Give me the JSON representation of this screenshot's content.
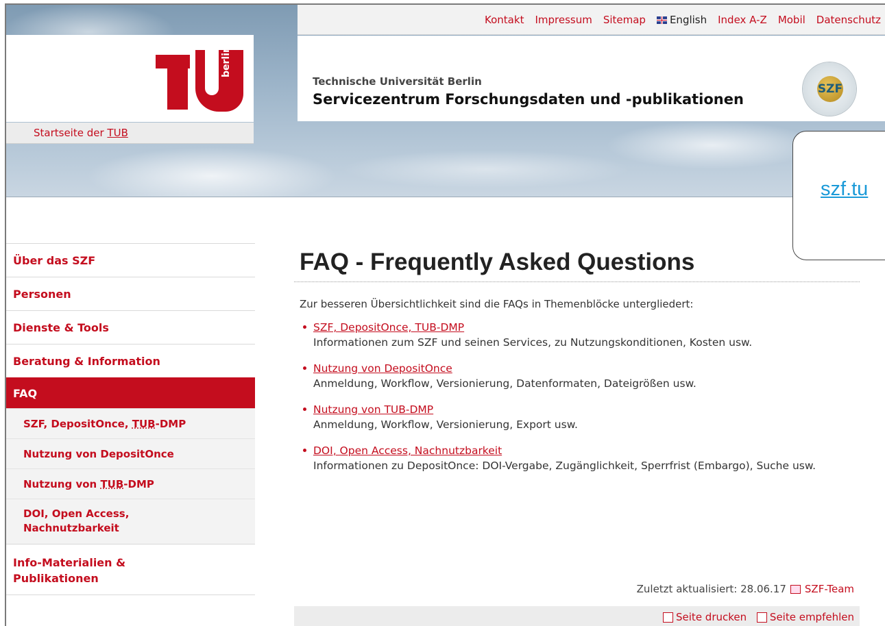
{
  "topnav": {
    "items": [
      "Kontakt",
      "Impressum",
      "Sitemap",
      "English",
      "Index A-Z",
      "Mobil",
      "Datenschutz"
    ]
  },
  "logo": {
    "text": "berlin"
  },
  "startbar": {
    "prefix": "Startseite der ",
    "abbr": "TUB"
  },
  "header": {
    "institution": "Technische Universität Berlin",
    "unit": "Servicezentrum Forschungsdaten und -publikationen",
    "seal": "SZF"
  },
  "callout": {
    "text": "szf.tu"
  },
  "sidebar": {
    "items": [
      {
        "label": "Über das SZF"
      },
      {
        "label": "Personen"
      },
      {
        "label": "Dienste & Tools"
      },
      {
        "label": "Beratung & Information"
      },
      {
        "label": "FAQ",
        "active": true
      }
    ],
    "sub": [
      {
        "label_a": "SZF, DepositOnce, ",
        "abbr": "TUB",
        "label_b": "-DMP"
      },
      {
        "label": "Nutzung von DepositOnce"
      },
      {
        "label_a": "Nutzung von ",
        "abbr": "TUB",
        "label_b": "-DMP"
      },
      {
        "line1": "DOI, Open Access,",
        "line2": "Nachnutzbarkeit"
      }
    ],
    "last": {
      "line1": "Info-Materialien &",
      "line2": "Publikationen"
    }
  },
  "main": {
    "title": "FAQ - Frequently Asked Questions",
    "intro": "Zur besseren Übersichtlichkeit sind die FAQs in Themenblöcke untergliedert:",
    "faqs": [
      {
        "link": "SZF, DepositOnce, TUB-DMP",
        "desc": "Informationen zum SZF und seinen Services, zu Nutzungskonditionen, Kosten usw."
      },
      {
        "link": "Nutzung von DepositOnce",
        "desc": "Anmeldung, Workflow, Versionierung, Datenformaten, Dateigrößen usw."
      },
      {
        "link": "Nutzung von TUB-DMP",
        "desc": "Anmeldung, Workflow, Versionierung, Export usw."
      },
      {
        "link": "DOI, Open Access, Nachnutzbarkeit",
        "desc": "Informationen zu DepositOnce: DOI-Vergabe, Zugänglichkeit, Sperrfrist (Embargo), Suche usw."
      }
    ],
    "updated_label": "Zuletzt aktualisiert: 28.06.17",
    "team": "SZF-Team",
    "print": "Seite drucken",
    "recommend": "Seite empfehlen"
  }
}
